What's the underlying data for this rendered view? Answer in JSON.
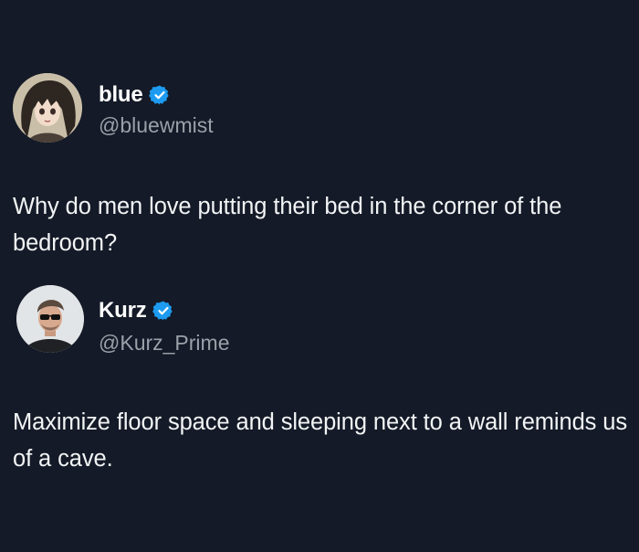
{
  "tweets": [
    {
      "display_name": "blue",
      "handle": "@bluewmist",
      "verified": true,
      "avatar_icon": "anime-girl-avatar",
      "text": "Why do men love putting their bed in the corner of the bedroom?"
    },
    {
      "display_name": "Kurz",
      "handle": "@Kurz_Prime",
      "verified": true,
      "avatar_icon": "man-with-sunglasses-avatar",
      "text": "Maximize floor space and sleeping next to a wall reminds us of a cave."
    }
  ],
  "colors": {
    "background": "#141a27",
    "text": "#f2f4f5",
    "handle": "#9aa1a9",
    "verified": "#1d9bf0"
  }
}
